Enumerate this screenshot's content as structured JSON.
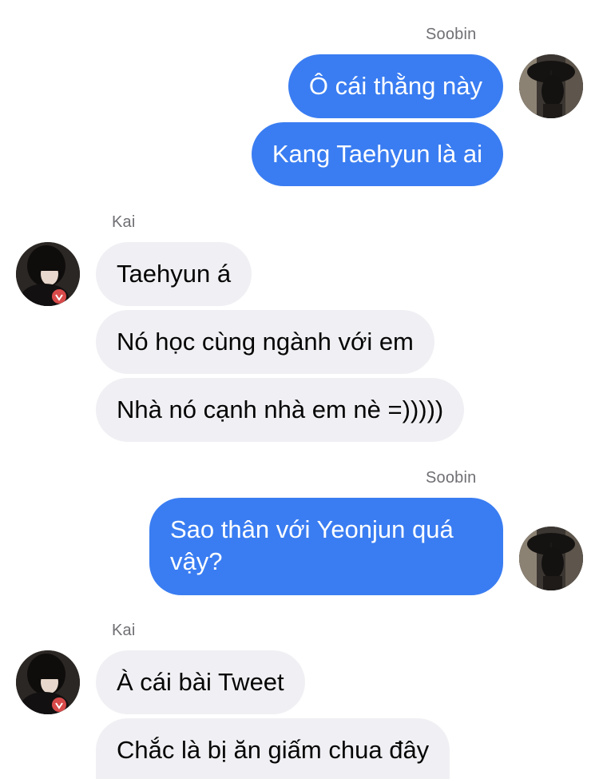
{
  "chat": {
    "groups": [
      {
        "sender": "Soobin",
        "direction": "outgoing",
        "messages": [
          "Ô cái thằng này",
          "Kang Taehyun là ai"
        ]
      },
      {
        "sender": "Kai",
        "direction": "incoming",
        "messages": [
          "Taehyun á",
          "Nó học cùng ngành với em",
          "Nhà nó cạnh nhà em nè =)))))"
        ]
      },
      {
        "sender": "Soobin",
        "direction": "outgoing",
        "messages": [
          "Sao thân với Yeonjun quá vậy?"
        ]
      },
      {
        "sender": "Kai",
        "direction": "incoming",
        "messages": [
          "À cái bài Tweet",
          "Chắc là bị ăn giấm chua đây"
        ]
      }
    ]
  },
  "colors": {
    "outgoing_bubble": "#3a7df2",
    "incoming_bubble": "#f0f0f4",
    "sender_name": "#6f6f74"
  },
  "avatars": {
    "soobin": "avatar-soobin-photo",
    "kai": "avatar-kai-photo"
  }
}
